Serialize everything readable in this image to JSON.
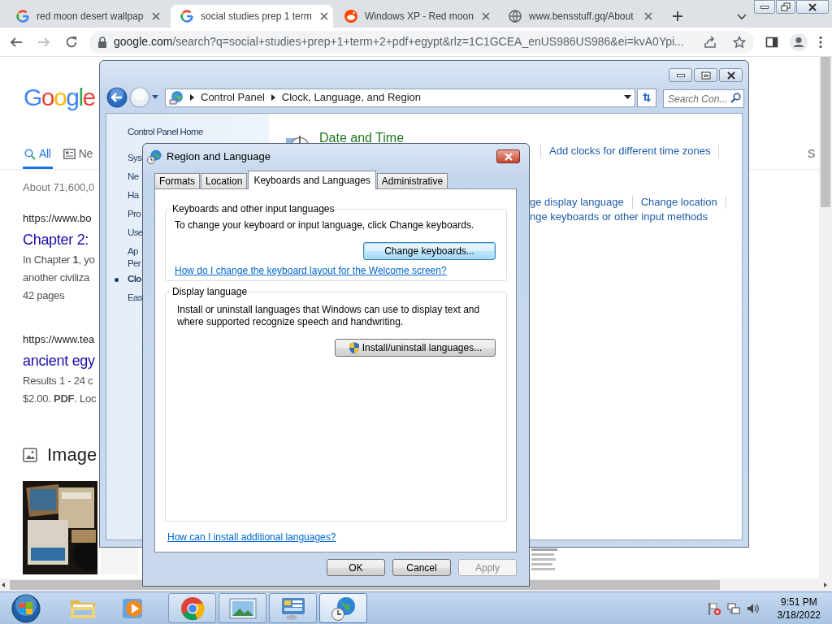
{
  "browser": {
    "tabs": [
      {
        "title": "red moon desert wallpap",
        "kind": "google",
        "selected": false
      },
      {
        "title": "social studies prep 1 term",
        "kind": "google",
        "selected": true
      },
      {
        "title": "Windows XP - Red moon",
        "kind": "reddit",
        "selected": false
      },
      {
        "title": "www.bensstuff.gq/About",
        "kind": "globe",
        "selected": false
      }
    ],
    "address": {
      "host": "google.com",
      "path": "/search?q=social+studies+prep+1+term+2+pdf+egypt&rlz=1C1GCEA_enUS986US986&ei=kvA0Ypi..."
    }
  },
  "google_page": {
    "logo": "Google",
    "search_tabs": [
      {
        "label": "All",
        "kind": "all",
        "selected": true
      },
      {
        "label": "Ne",
        "kind": "news",
        "selected": false
      }
    ],
    "right_tab": "S",
    "result_stats": "About 71,600,0",
    "results": [
      {
        "url": "https://www.bo",
        "title": "Chapter 2:",
        "lines": [
          "In Chapter **1**, yo",
          "another civiliza",
          "42 pages"
        ]
      },
      {
        "url": "https://www.tea",
        "title": "ancient egy",
        "lines": [
          "Results 1 - 24 c",
          "$2.00. **PDF**. Loc"
        ]
      }
    ],
    "images_heading": "Image"
  },
  "control_panel": {
    "breadcrumb": [
      "Control Panel",
      "Clock, Language, and Region"
    ],
    "search_placeholder": "Search Con...",
    "sidebar": [
      {
        "lines": [
          "Control Panel Home"
        ],
        "selected": false
      },
      {
        "lines": [
          "Sys"
        ],
        "selected": false
      },
      {
        "lines": [
          "Ne"
        ],
        "selected": false
      },
      {
        "lines": [
          "Ha"
        ],
        "selected": false
      },
      {
        "lines": [
          "Pro"
        ],
        "selected": false
      },
      {
        "lines": [
          "Use"
        ],
        "selected": false
      },
      {
        "lines": [
          "Ap",
          "Per"
        ],
        "selected": false
      },
      {
        "lines": [
          "Clo"
        ],
        "selected": true
      },
      {
        "lines": [
          "Eas"
        ],
        "selected": false
      }
    ],
    "category": {
      "title": "Date and Time",
      "links": [
        "Add clocks for different time zones"
      ]
    },
    "link_rows": [
      [
        "ge display language",
        "Change location"
      ],
      [
        "nge keyboards or other input methods"
      ]
    ]
  },
  "dialog": {
    "title": "Region and Language",
    "tabs": [
      {
        "label": "Formats",
        "selected": false
      },
      {
        "label": "Location",
        "selected": false
      },
      {
        "label": "Keyboards and Languages",
        "selected": true
      },
      {
        "label": "Administrative",
        "selected": false
      }
    ],
    "groups": [
      {
        "legend": "Keyboards and other input languages",
        "text": "To change your keyboard or input language, click Change keyboards.",
        "button": "Change keyboards...",
        "shield": false,
        "focused": true,
        "link": "How do I change the keyboard layout for the Welcome screen?"
      },
      {
        "legend": "Display language",
        "text": "Install or uninstall languages that Windows can use to display text and where supported recognize speech and handwriting.",
        "button": "Install/uninstall languages...",
        "shield": true,
        "focused": false
      }
    ],
    "footer_link": "How can I install additional languages?",
    "buttons": [
      {
        "label": "OK",
        "disabled": false
      },
      {
        "label": "Cancel",
        "disabled": false
      },
      {
        "label": "Apply",
        "disabled": true
      }
    ]
  },
  "taskbar": {
    "apps": [
      {
        "kind": "folder",
        "running": false,
        "active": false
      },
      {
        "kind": "media",
        "running": false,
        "active": false
      },
      {
        "kind": "chrome",
        "running": true,
        "active": false
      },
      {
        "kind": "photos",
        "running": true,
        "active": false
      },
      {
        "kind": "control-panel",
        "running": true,
        "active": false
      },
      {
        "kind": "region",
        "running": true,
        "active": true
      }
    ],
    "clock": {
      "time": "9:51 PM",
      "date": "3/18/2022"
    }
  }
}
